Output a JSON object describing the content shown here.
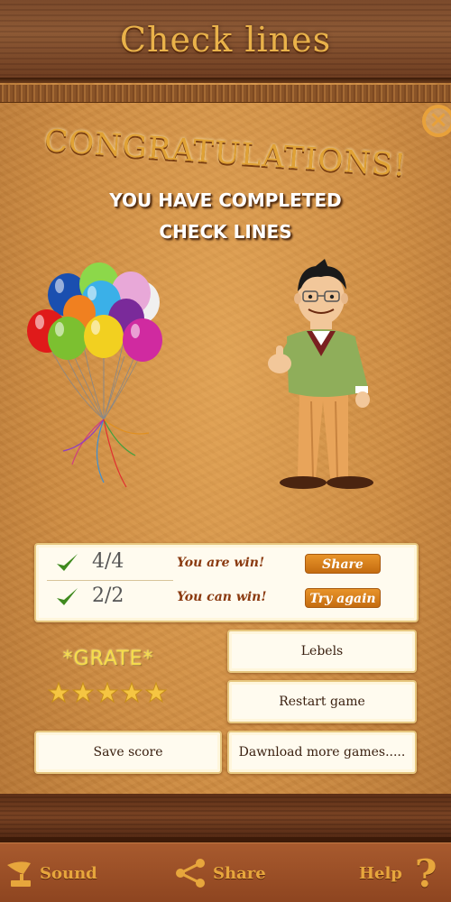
{
  "header": {
    "title": "Check lines"
  },
  "dialog": {
    "heading": "CONGRATULATIONS!",
    "subtitle_line1": "YOU HAVE COMPLETED",
    "subtitle_line2": "CHECK LINES"
  },
  "results": {
    "rows": [
      {
        "score": "4/4",
        "message": "You are win!",
        "action": "Share"
      },
      {
        "score": "2/2",
        "message": "You can win!",
        "action": "Try again"
      }
    ]
  },
  "rating": {
    "label": "*GRATE*",
    "stars": 5,
    "max_stars": 5
  },
  "buttons": {
    "levels": "Lebels",
    "restart": "Restart game",
    "save": "Save score",
    "download": "Dawnload more games....."
  },
  "footer": {
    "sound": "Sound",
    "share": "Share",
    "help": "Help"
  },
  "colors": {
    "accent": "#e7a63c",
    "star": "#f5c542",
    "pill": "#d9801c"
  }
}
